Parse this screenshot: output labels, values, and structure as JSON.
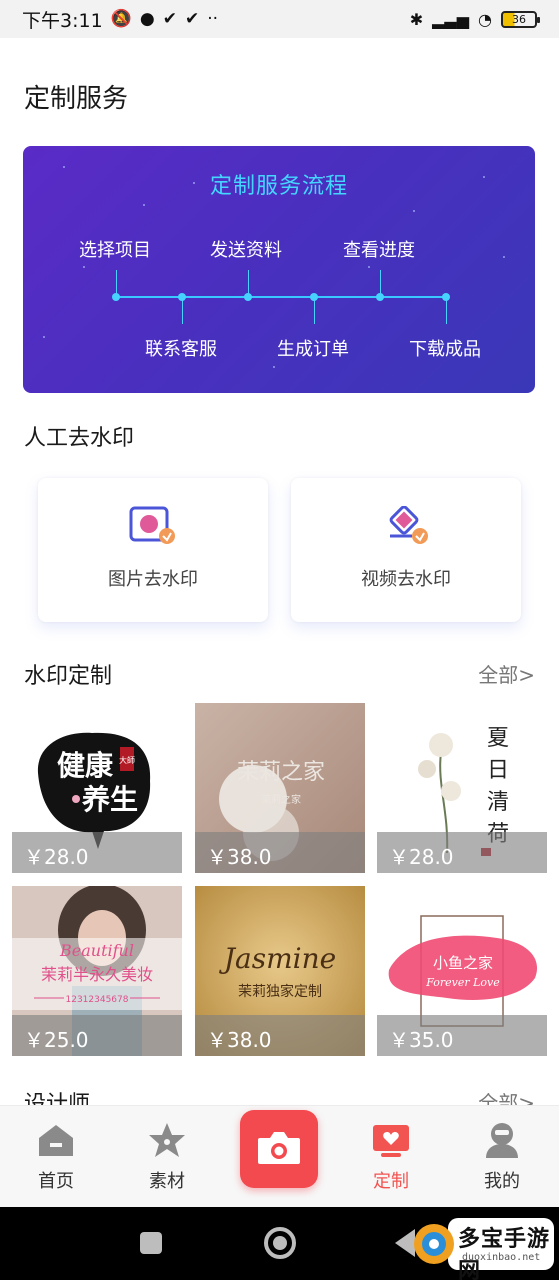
{
  "status_bar": {
    "time": "下午3:11",
    "battery": "36"
  },
  "page_title": "定制服务",
  "process": {
    "title": "定制服务流程",
    "steps_top": [
      "选择项目",
      "发送资料",
      "查看进度"
    ],
    "steps_bottom": [
      "联系客服",
      "生成订单",
      "下载成品"
    ]
  },
  "manual_removal": {
    "title": "人工去水印",
    "cards": [
      {
        "label": "图片去水印",
        "icon": "image-watermark-icon"
      },
      {
        "label": "视频去水印",
        "icon": "video-watermark-icon"
      }
    ]
  },
  "watermark_custom": {
    "title": "水印定制",
    "see_all": "全部>",
    "items": [
      {
        "price": "￥28.0",
        "art_text": [
          "健康",
          "养生"
        ],
        "seal": "大師"
      },
      {
        "price": "￥38.0",
        "art_text": [
          "茉莉之家"
        ],
        "sub": "茉莉之家"
      },
      {
        "price": "￥28.0",
        "art_text": [
          "夏",
          "日",
          "清",
          "荷"
        ]
      },
      {
        "price": "￥25.0",
        "art_text": [
          "Beautiful",
          "茉莉半永久美妆",
          "12312345678"
        ]
      },
      {
        "price": "￥38.0",
        "art_text": [
          "Jasmine",
          "茉莉独家定制"
        ]
      },
      {
        "price": "￥35.0",
        "art_text": [
          "小鱼之家",
          "Forever Love"
        ]
      }
    ]
  },
  "designers": {
    "title": "设计师",
    "see_all": "全部>"
  },
  "bottom_nav": [
    {
      "label": "首页",
      "icon": "home-icon"
    },
    {
      "label": "素材",
      "icon": "star-icon"
    },
    {
      "label": "",
      "icon": "camera-icon"
    },
    {
      "label": "定制",
      "icon": "custom-icon",
      "active": true
    },
    {
      "label": "我的",
      "icon": "profile-icon"
    }
  ],
  "logo": {
    "text": "多宝手游网",
    "url": "duoxinbao.net"
  },
  "colors": {
    "accent": "#f25451",
    "banner_start": "#5a2bc7",
    "banner_end": "#3a38b8",
    "timeline": "#39c8ff"
  }
}
